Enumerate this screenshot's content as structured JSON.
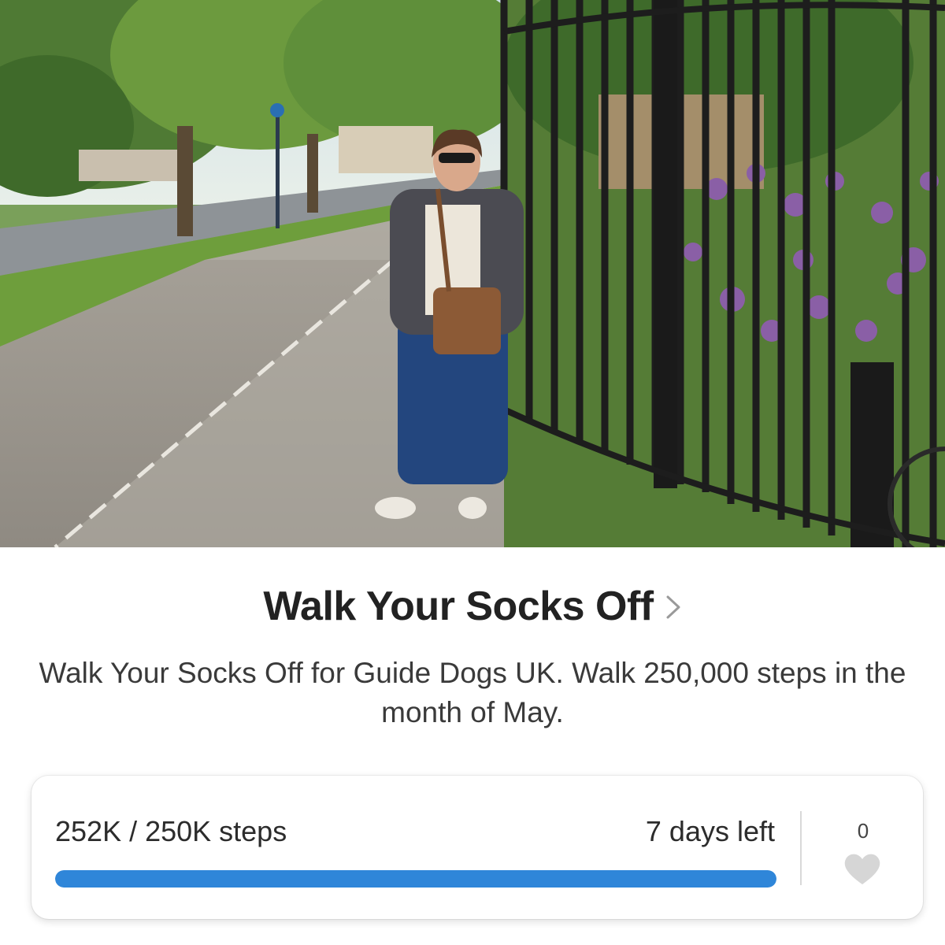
{
  "hero": {
    "image_description_icon": "photo-hero"
  },
  "challenge": {
    "title": "Walk Your Socks Off",
    "description": "Walk Your Socks Off for Guide Dogs UK. Walk 250,000 steps in the month of May."
  },
  "progress": {
    "steps_text": "252K / 250K steps",
    "days_left_text": "7 days left",
    "fraction": 1.0
  },
  "likes": {
    "count": "0",
    "icon": "heart-icon"
  },
  "colors": {
    "accent": "#2f86d9",
    "track": "#e3e9f1",
    "heart": "#d6d6d6"
  }
}
